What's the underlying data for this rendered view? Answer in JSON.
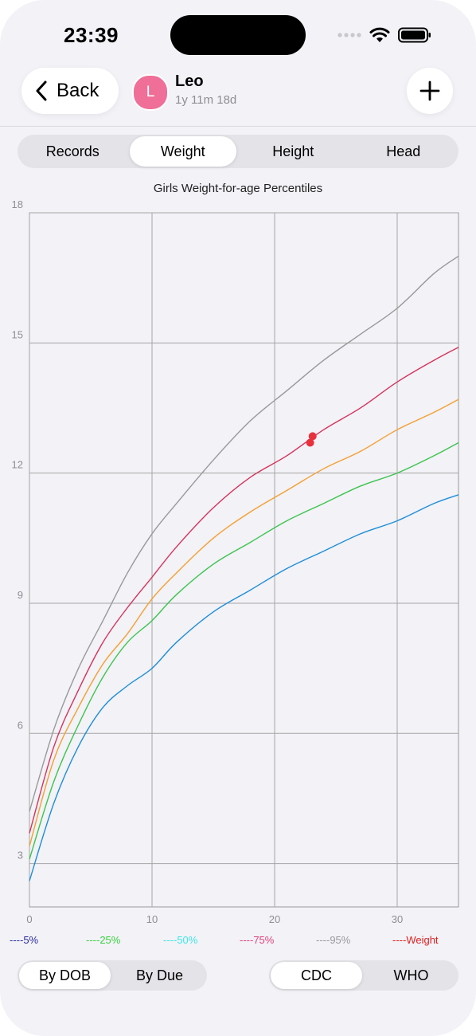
{
  "status": {
    "time": "23:39"
  },
  "header": {
    "back_label": "Back",
    "avatar_initial": "L",
    "child_name": "Leo",
    "child_age": "1y 11m 18d"
  },
  "tabs": [
    {
      "label": "Records",
      "active": false
    },
    {
      "label": "Weight",
      "active": true
    },
    {
      "label": "Height",
      "active": false
    },
    {
      "label": "Head",
      "active": false
    }
  ],
  "chart_data": {
    "type": "line",
    "title": "Girls Weight-for-age Percentiles",
    "xlabel": "",
    "ylabel": "",
    "xlim": [
      0,
      35
    ],
    "ylim": [
      2,
      18
    ],
    "xticks": [
      0,
      10,
      20,
      30
    ],
    "yticks": [
      3,
      6,
      9,
      12,
      15,
      18
    ],
    "grid": true,
    "series": [
      {
        "color": "#1f8ed6",
        "x": [
          0,
          2,
          4,
          6,
          8,
          10,
          12,
          15,
          18,
          21,
          24,
          27,
          30,
          33,
          35
        ],
        "y": [
          2.6,
          4.4,
          5.7,
          6.6,
          7.1,
          7.5,
          8.1,
          8.8,
          9.3,
          9.8,
          10.2,
          10.6,
          10.9,
          11.3,
          11.5
        ]
      },
      {
        "color": "#3dc44d",
        "x": [
          0,
          2,
          4,
          6,
          8,
          10,
          12,
          15,
          18,
          21,
          24,
          27,
          30,
          33,
          35
        ],
        "y": [
          3.1,
          4.9,
          6.2,
          7.3,
          8.1,
          8.6,
          9.2,
          9.9,
          10.4,
          10.9,
          11.3,
          11.7,
          12.0,
          12.4,
          12.7
        ]
      },
      {
        "color": "#f4a030",
        "x": [
          0,
          2,
          4,
          6,
          8,
          10,
          12,
          15,
          18,
          21,
          24,
          27,
          30,
          33,
          35
        ],
        "y": [
          3.4,
          5.4,
          6.6,
          7.6,
          8.3,
          9.1,
          9.7,
          10.5,
          11.1,
          11.6,
          12.1,
          12.5,
          13.0,
          13.4,
          13.7
        ]
      },
      {
        "color": "#d6335a",
        "x": [
          0,
          2,
          4,
          6,
          8,
          10,
          12,
          15,
          18,
          21,
          24,
          27,
          30,
          33,
          35
        ],
        "y": [
          3.7,
          5.7,
          7.0,
          8.1,
          8.9,
          9.6,
          10.3,
          11.2,
          11.9,
          12.4,
          13.0,
          13.5,
          14.1,
          14.6,
          14.9
        ]
      },
      {
        "color": "#999999",
        "x": [
          0,
          2,
          4,
          6,
          8,
          10,
          12,
          15,
          18,
          21,
          24,
          27,
          30,
          33,
          35
        ],
        "y": [
          4.2,
          6.1,
          7.5,
          8.6,
          9.7,
          10.6,
          11.3,
          12.3,
          13.2,
          13.9,
          14.6,
          15.2,
          15.8,
          16.6,
          17.0
        ]
      }
    ],
    "points": {
      "color": "#e8313d",
      "x": [
        22.9,
        23.1
      ],
      "y": [
        12.7,
        12.85
      ]
    },
    "legend": [
      {
        "label": "----5%",
        "color": "#2c2c9c"
      },
      {
        "label": "----25%",
        "color": "#3ad13e"
      },
      {
        "label": "----50%",
        "color": "#3de6e6"
      },
      {
        "label": "----75%",
        "color": "#e0417f"
      },
      {
        "label": "----95%",
        "color": "#9a9a9a"
      },
      {
        "label": "----Weight",
        "color": "#e02020"
      }
    ]
  },
  "date_basis": {
    "options": [
      "By DOB",
      "By Due"
    ],
    "selected": "By DOB"
  },
  "standard": {
    "options": [
      "CDC",
      "WHO"
    ],
    "selected": "CDC"
  }
}
